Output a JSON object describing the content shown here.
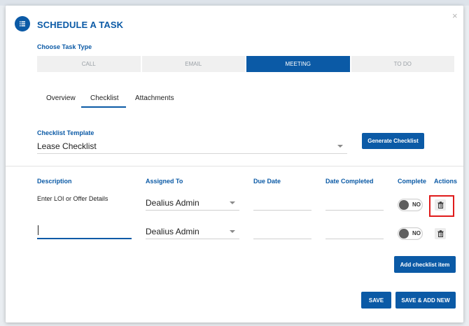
{
  "header": {
    "title": "SCHEDULE A TASK",
    "close_glyph": "×",
    "icon": "list-icon"
  },
  "task_type": {
    "label": "Choose Task Type",
    "options": [
      "CALL",
      "EMAIL",
      "MEETING",
      "TO DO"
    ],
    "selected": "MEETING"
  },
  "tabs": [
    {
      "label": "Overview"
    },
    {
      "label": "Checklist",
      "active": true
    },
    {
      "label": "Attachments"
    }
  ],
  "template": {
    "label": "Checklist Template",
    "value": "Lease Checklist",
    "button": "Generate Checklist"
  },
  "table": {
    "columns": [
      "Description",
      "Assigned To",
      "Due Date",
      "Date Completed",
      "Complete",
      "Actions"
    ],
    "rows": [
      {
        "description": "Enter LOI or Offer Details",
        "assigned_to": "Dealius Admin",
        "due_date": "",
        "date_completed": "",
        "complete": "NO"
      },
      {
        "description": "",
        "assigned_to": "Dealius Admin",
        "due_date": "",
        "date_completed": "",
        "complete": "NO"
      }
    ]
  },
  "buttons": {
    "add_item": "Add checklist item",
    "save": "SAVE",
    "save_add_new": "SAVE & ADD NEW"
  },
  "colors": {
    "accent": "#0b5aa6",
    "highlight": "#e01b1b"
  }
}
